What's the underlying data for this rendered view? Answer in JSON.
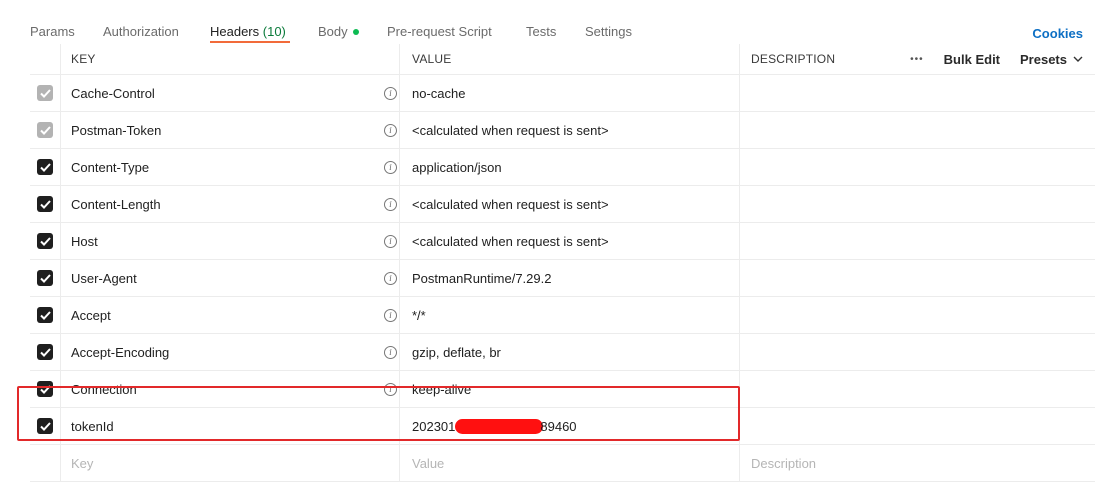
{
  "tabs": {
    "params": "Params",
    "authorization": "Authorization",
    "headers": "Headers",
    "headers_count": "(10)",
    "body": "Body",
    "prerequest": "Pre-request Script",
    "tests": "Tests",
    "settings": "Settings",
    "cookies": "Cookies"
  },
  "table": {
    "columns": {
      "key": "KEY",
      "value": "VALUE",
      "description": "DESCRIPTION"
    },
    "tools": {
      "more": "•••",
      "bulk_edit": "Bulk Edit",
      "presets": "Presets"
    },
    "rows": [
      {
        "key": "Cache-Control",
        "value": "no-cache",
        "checked": true,
        "disabled": true
      },
      {
        "key": "Postman-Token",
        "value": "<calculated when request is sent>",
        "checked": true,
        "disabled": true
      },
      {
        "key": "Content-Type",
        "value": "application/json",
        "checked": true,
        "disabled": false
      },
      {
        "key": "Content-Length",
        "value": "<calculated when request is sent>",
        "checked": true,
        "disabled": false
      },
      {
        "key": "Host",
        "value": "<calculated when request is sent>",
        "checked": true,
        "disabled": false
      },
      {
        "key": "User-Agent",
        "value": "PostmanRuntime/7.29.2",
        "checked": true,
        "disabled": false
      },
      {
        "key": "Accept",
        "value": "*/*",
        "checked": true,
        "disabled": false
      },
      {
        "key": "Accept-Encoding",
        "value": "gzip, deflate, br",
        "checked": true,
        "disabled": false
      },
      {
        "key": "Connection",
        "value": "keep-alive",
        "checked": true,
        "disabled": false
      }
    ],
    "custom_row": {
      "key": "tokenId",
      "value_prefix": "202301",
      "value_suffix": "89460",
      "checked": true
    },
    "new_row": {
      "key_placeholder": "Key",
      "value_placeholder": "Value",
      "description_placeholder": "Description"
    }
  },
  "colors": {
    "accent_orange": "#f26b3a",
    "cookies_blue": "#0d6fc4",
    "body_dot": "#0cbb52",
    "highlight_red": "#e2292a"
  }
}
